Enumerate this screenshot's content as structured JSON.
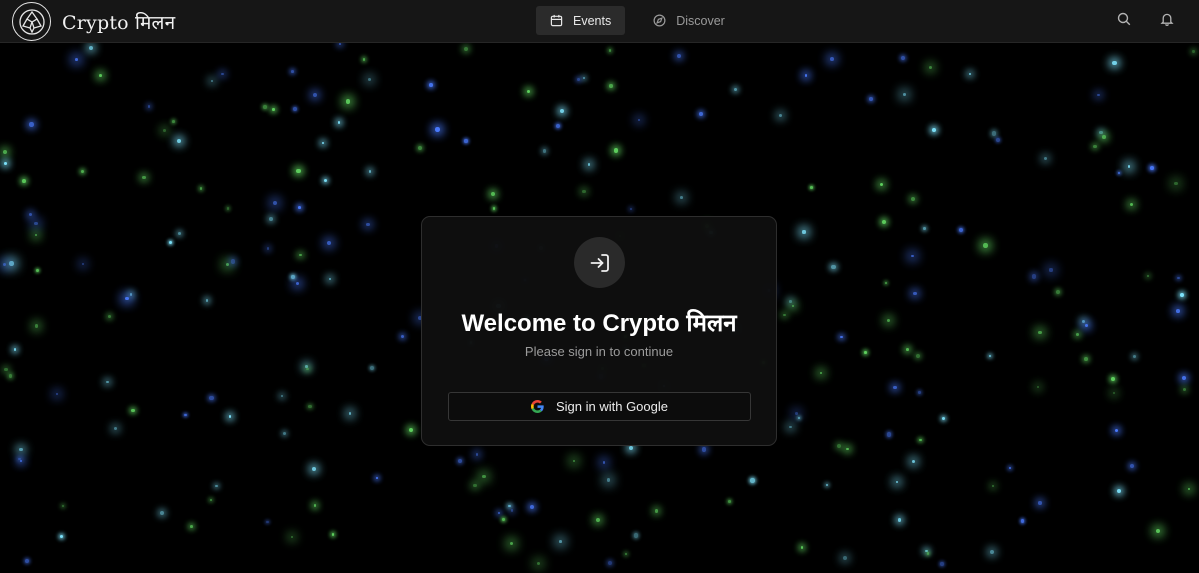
{
  "brand": {
    "name": "Crypto मिलन",
    "logo_icon": "coin-logo-icon"
  },
  "nav": {
    "items": [
      {
        "label": "Events",
        "icon": "calendar-icon",
        "active": true
      },
      {
        "label": "Discover",
        "icon": "compass-icon",
        "active": false
      }
    ]
  },
  "header_actions": [
    "search-icon",
    "bell-icon"
  ],
  "login": {
    "icon": "sign-in-icon",
    "title": "Welcome to Crypto मिलन",
    "subtitle": "Please sign in to continue",
    "button_label": "Sign in with Google",
    "button_icon": "google-icon"
  },
  "colors": {
    "background": "#000000",
    "topbar": "#161616",
    "card": "#0e0e0e",
    "star_green": "#5fd35f",
    "star_cyan": "#7fe6ff",
    "star_blue": "#4a7bff"
  }
}
